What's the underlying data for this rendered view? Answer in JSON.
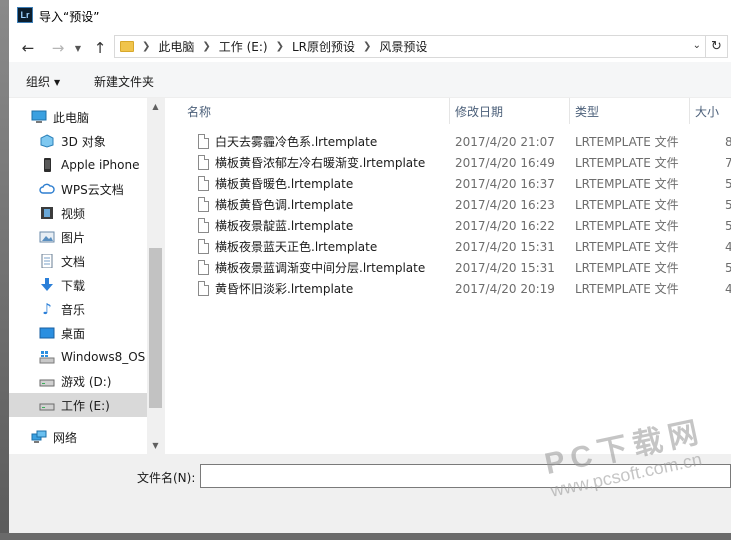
{
  "window": {
    "title": "导入“预设”",
    "app_icon_text": "Lr"
  },
  "address": {
    "crumbs": [
      "此电脑",
      "工作 (E:)",
      "LR原创预设",
      "风景预设"
    ]
  },
  "toolbar": {
    "organize_label": "组织",
    "new_folder_label": "新建文件夹"
  },
  "nav": {
    "items": [
      {
        "label": "此电脑",
        "icon": "computer-icon"
      },
      {
        "label": "3D 对象",
        "icon": "3d-objects-icon"
      },
      {
        "label": "Apple iPhone",
        "icon": "iphone-icon"
      },
      {
        "label": "WPS云文档",
        "icon": "cloud-icon"
      },
      {
        "label": "视频",
        "icon": "video-icon"
      },
      {
        "label": "图片",
        "icon": "pictures-icon"
      },
      {
        "label": "文档",
        "icon": "documents-icon"
      },
      {
        "label": "下载",
        "icon": "download-icon"
      },
      {
        "label": "音乐",
        "icon": "music-icon"
      },
      {
        "label": "桌面",
        "icon": "desktop-icon"
      },
      {
        "label": "Windows8_OS",
        "icon": "drive-icon"
      },
      {
        "label": "游戏 (D:)",
        "icon": "drive-icon"
      },
      {
        "label": "工作 (E:)",
        "icon": "drive-icon"
      },
      {
        "label": "网络",
        "icon": "network-icon"
      }
    ]
  },
  "columns": {
    "name": "名称",
    "date": "修改日期",
    "type": "类型",
    "size": "大小"
  },
  "files": [
    {
      "name": "白天去雾霾冷色系.lrtemplate",
      "date": "2017/4/20 21:07",
      "type": "LRTEMPLATE 文件",
      "size": "8"
    },
    {
      "name": "横板黄昏浓郁左冷右暖渐变.lrtemplate",
      "date": "2017/4/20 16:49",
      "type": "LRTEMPLATE 文件",
      "size": "7"
    },
    {
      "name": "横板黄昏暖色.lrtemplate",
      "date": "2017/4/20 16:37",
      "type": "LRTEMPLATE 文件",
      "size": "5"
    },
    {
      "name": "横板黄昏色调.lrtemplate",
      "date": "2017/4/20 16:23",
      "type": "LRTEMPLATE 文件",
      "size": "5"
    },
    {
      "name": "横板夜景靛蓝.lrtemplate",
      "date": "2017/4/20 16:22",
      "type": "LRTEMPLATE 文件",
      "size": "5"
    },
    {
      "name": "横板夜景蓝天正色.lrtemplate",
      "date": "2017/4/20 15:31",
      "type": "LRTEMPLATE 文件",
      "size": "4"
    },
    {
      "name": "横板夜景蓝调渐变中间分层.lrtemplate",
      "date": "2017/4/20 15:31",
      "type": "LRTEMPLATE 文件",
      "size": "5"
    },
    {
      "name": "黄昏怀旧淡彩.lrtemplate",
      "date": "2017/4/20 20:19",
      "type": "LRTEMPLATE 文件",
      "size": "4"
    }
  ],
  "bottom": {
    "filename_label": "文件名(N):",
    "filename_value": ""
  },
  "watermark": {
    "line1": "PC下载网",
    "line2": "www.pcsoft.com.cn"
  }
}
